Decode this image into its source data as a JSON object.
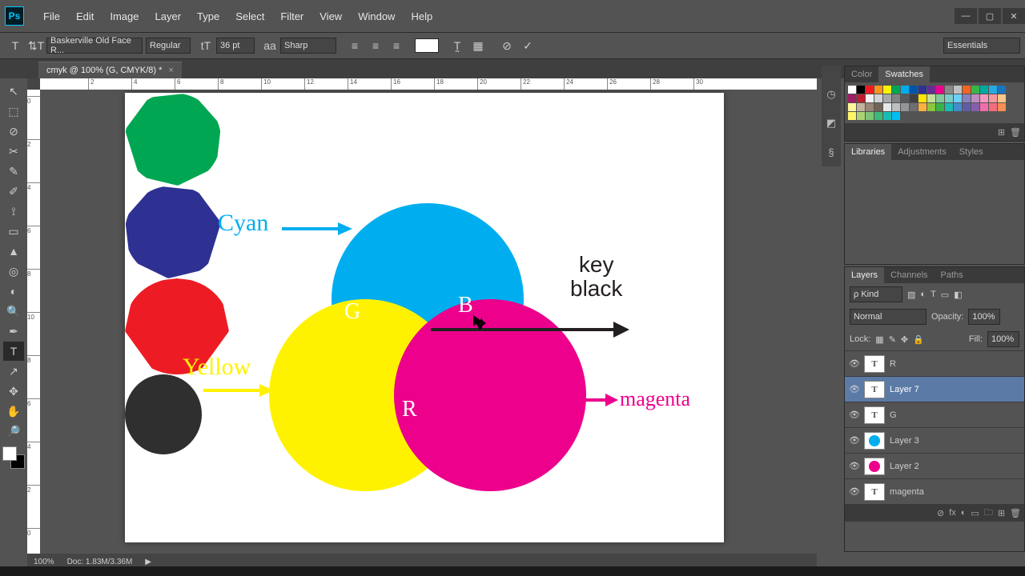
{
  "app": {
    "logo_text": "Ps"
  },
  "menu": [
    "File",
    "Edit",
    "Image",
    "Layer",
    "Type",
    "Select",
    "Filter",
    "View",
    "Window",
    "Help"
  ],
  "window_controls": {
    "min": "—",
    "max": "▢",
    "close": "✕"
  },
  "options": {
    "tool_icon": "T",
    "orient_icon": "⇅T",
    "font": "Baskerville Old Face R...",
    "weight": "Regular",
    "size_icon": "tT",
    "size": "36 pt",
    "aa_icon": "aa",
    "aa": "Sharp",
    "align_left": "≡",
    "align_center": "≡",
    "align_right": "≡",
    "swatch": "#ffffff",
    "warp_icon": "T̰",
    "panel_icon": "▦",
    "cancel_icon": "⊘",
    "commit_icon": "✓",
    "workspace": "Essentials"
  },
  "tab": {
    "label": "cmyk @ 100% (G, CMYK/8) *",
    "close": "×"
  },
  "ruler_h": [
    "2",
    "4",
    "6",
    "8",
    "10",
    "12",
    "14",
    "16",
    "18",
    "20",
    "22",
    "24",
    "26",
    "28",
    "30"
  ],
  "ruler_v": [
    "0",
    "2",
    "4",
    "6",
    "8",
    "10",
    "8",
    "6",
    "4",
    "2",
    "0"
  ],
  "status": {
    "zoom": "100%",
    "doc": "Doc: 1.83M/3.36M",
    "play": "▶"
  },
  "tools": [
    "↖",
    "⬚",
    "⊘",
    "✂",
    "✎",
    "✐",
    "⟟",
    "▭",
    "▲",
    "◎",
    "◐",
    "🔍",
    "✒",
    "T",
    "↗",
    "✥",
    "✋",
    "🔎"
  ],
  "panels": {
    "color_tabs": [
      "Color",
      "Swatches"
    ],
    "lib_tabs": [
      "Libraries",
      "Adjustments",
      "Styles"
    ],
    "layer_tabs": [
      "Layers",
      "Channels",
      "Paths"
    ],
    "kind_placeholder": "ρ Kind",
    "blend": "Normal",
    "opacity_label": "Opacity:",
    "opacity": "100%",
    "lock_label": "Lock:",
    "fill_label": "Fill:",
    "fill": "100%",
    "layers": [
      {
        "thumb": "T",
        "name": "R"
      },
      {
        "thumb": "T",
        "name": "Layer 7",
        "sel": true
      },
      {
        "thumb": "T",
        "name": "G"
      },
      {
        "thumb": "C",
        "color": "#00aeef",
        "name": "Layer 3"
      },
      {
        "thumb": "C",
        "color": "#ec008c",
        "name": "Layer 2"
      },
      {
        "thumb": "T",
        "name": "magenta"
      }
    ],
    "footer_icons": [
      "⊘",
      "fx",
      "◐",
      "▭",
      "🗀",
      "⊞",
      "🗑"
    ]
  },
  "diagram": {
    "cyan": "Cyan",
    "yellow": "Yellow",
    "magenta": "magenta",
    "key_line1": "key",
    "key_line2": "black",
    "G": "G",
    "B": "B",
    "R": "R"
  },
  "swatch_colors": [
    "#ffffff",
    "#000000",
    "#ed1c24",
    "#f7941d",
    "#fff200",
    "#00a651",
    "#00aeef",
    "#0054a6",
    "#2e3192",
    "#662d91",
    "#ec008c",
    "#898989",
    "#c0c0c0",
    "#f26522",
    "#39b54a",
    "#00a99d",
    "#27aae1",
    "#1b75bb",
    "#9e1f63",
    "#be1e2d",
    "#f1f1f1",
    "#d1d3d4",
    "#a7a9ac",
    "#808285",
    "#58595b",
    "#414042",
    "#ffe600",
    "#c4df9b",
    "#82ca9c",
    "#7accc8",
    "#6dcff6",
    "#8781bd",
    "#bd8cbf",
    "#f49ac1",
    "#f5989d",
    "#fdc689",
    "#fff799",
    "#c2b59b",
    "#998675",
    "#736357",
    "#e6e7e8",
    "#bcbec0",
    "#939598",
    "#6d6e71",
    "#fbb040",
    "#8dc63f",
    "#37b34a",
    "#1cbbb4",
    "#448ccb",
    "#605ca8",
    "#8560a8",
    "#f06eaa",
    "#f26d7d",
    "#f68e56",
    "#fff568",
    "#acd373",
    "#7cc576",
    "#3cb878",
    "#1abbb4",
    "#00bff3"
  ]
}
